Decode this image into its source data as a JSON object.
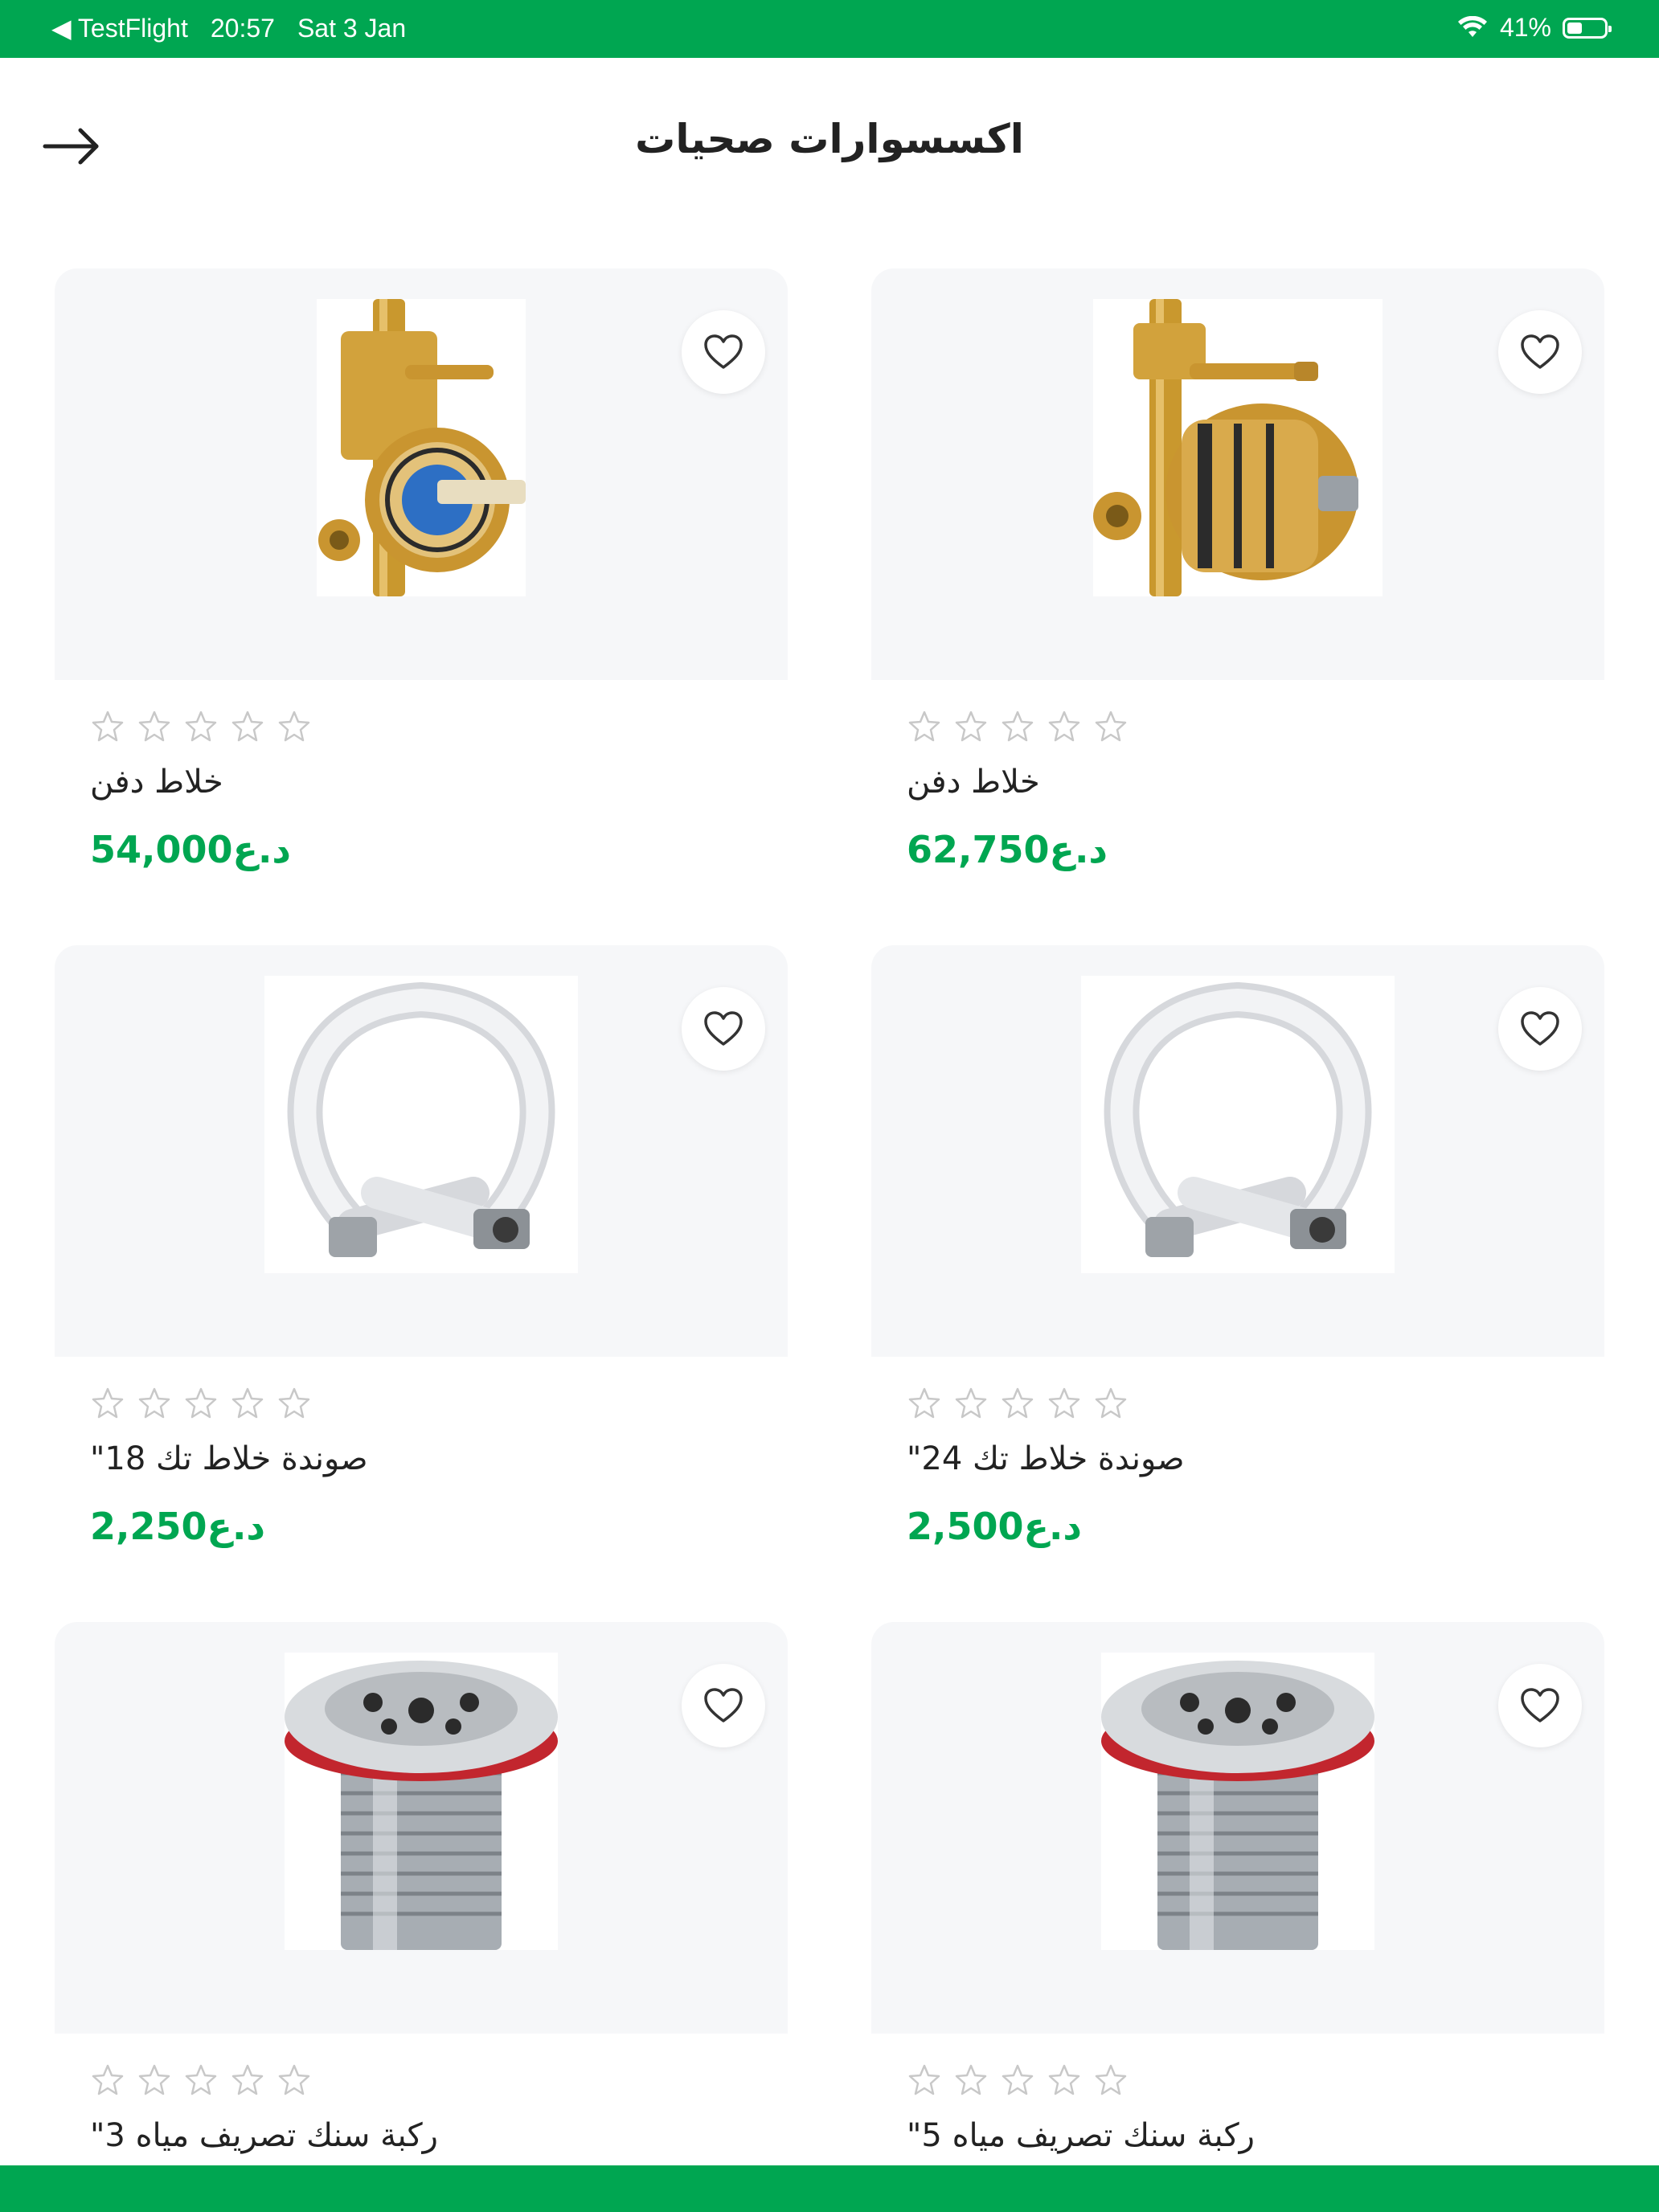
{
  "status_bar": {
    "back_app": "◀ TestFlight",
    "time": "20:57",
    "date": "Sat 3 Jan",
    "battery": "41%",
    "battery_level": 0.41
  },
  "header": {
    "title": "اكسسوارات صحيات",
    "back_icon": "arrow-right-icon"
  },
  "products": [
    {
      "name": "خلاط دفن",
      "price": "62,750د.ع",
      "rating": 0,
      "image": "mixer-valve-large"
    },
    {
      "name": "خلاط دفن",
      "price": "54,000د.ع",
      "rating": 0,
      "image": "mixer-valve-small"
    },
    {
      "name": "صوندة خلاط تك 24\"",
      "price": "2,500د.ع",
      "rating": 0,
      "image": "braided-hose"
    },
    {
      "name": "صوندة خلاط تك 18\"",
      "price": "2,250د.ع",
      "rating": 0,
      "image": "braided-hose"
    },
    {
      "name": "ركبة سنك تصريف مياه 5\"",
      "price": "",
      "rating": 0,
      "image": "sink-drain"
    },
    {
      "name": "ركبة سنك تصريف مياه 3\"",
      "price": "",
      "rating": 0,
      "image": "sink-drain"
    }
  ],
  "colors": {
    "brand": "#00a651",
    "card_bg": "#f6f7f9",
    "star_empty": "#c8c8c8"
  }
}
